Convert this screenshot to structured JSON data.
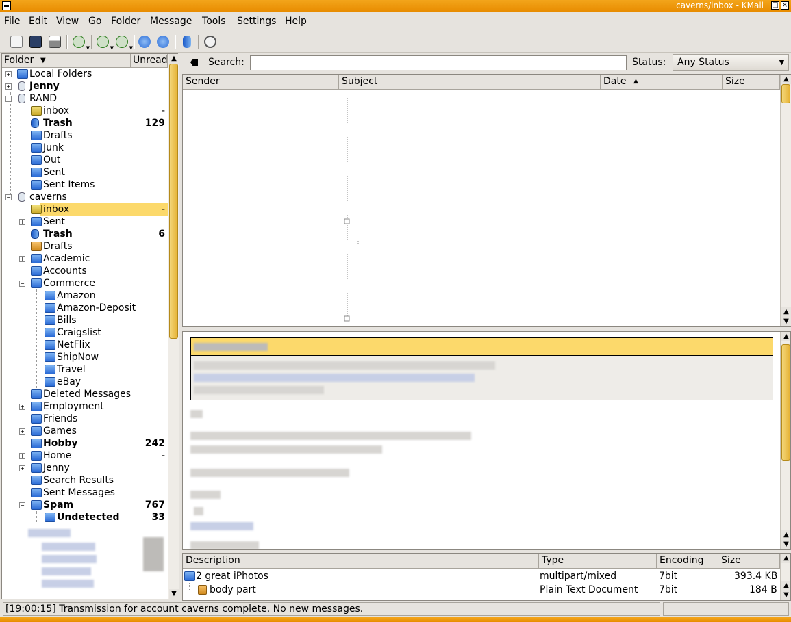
{
  "window": {
    "title": "caverns/inbox - KMail"
  },
  "menu": [
    "File",
    "Edit",
    "View",
    "Go",
    "Folder",
    "Message",
    "Tools",
    "Settings",
    "Help"
  ],
  "toolbar": {
    "icons": [
      "new-message-icon",
      "save-icon",
      "print-icon",
      "check-mail-icon",
      "reply-icon",
      "forward-icon",
      "previous-icon",
      "next-icon",
      "trash-icon",
      "find-icon"
    ]
  },
  "folder_pane": {
    "columns": [
      "Folder",
      "Unread"
    ],
    "folders": [
      {
        "name": "Local Folders",
        "count": "",
        "icon": "folder-icon",
        "indent": 0,
        "expander": "+",
        "bold": false
      },
      {
        "name": "Jenny",
        "count": "",
        "icon": "account-icon",
        "indent": 0,
        "expander": "+",
        "bold": true
      },
      {
        "name": "RAND",
        "count": "",
        "icon": "account-icon",
        "indent": 0,
        "expander": "-",
        "bold": false
      },
      {
        "name": "inbox",
        "count": "-",
        "icon": "inbox-icon",
        "indent": 1,
        "expander": "",
        "bold": false
      },
      {
        "name": "Trash",
        "count": "129",
        "icon": "trash-icon",
        "indent": 1,
        "expander": "",
        "bold": true
      },
      {
        "name": "Drafts",
        "count": "",
        "icon": "folder-icon",
        "indent": 1,
        "expander": "",
        "bold": false
      },
      {
        "name": "Junk",
        "count": "",
        "icon": "folder-icon",
        "indent": 1,
        "expander": "",
        "bold": false
      },
      {
        "name": "Out",
        "count": "",
        "icon": "folder-icon",
        "indent": 1,
        "expander": "",
        "bold": false
      },
      {
        "name": "Sent",
        "count": "",
        "icon": "folder-icon",
        "indent": 1,
        "expander": "",
        "bold": false
      },
      {
        "name": "Sent Items",
        "count": "",
        "icon": "folder-icon",
        "indent": 1,
        "expander": "",
        "bold": false
      },
      {
        "name": "caverns",
        "count": "",
        "icon": "account-icon",
        "indent": 0,
        "expander": "-",
        "bold": false
      },
      {
        "name": "inbox",
        "count": "-",
        "icon": "inbox-icon",
        "indent": 1,
        "expander": "",
        "bold": false,
        "selected": true
      },
      {
        "name": "Sent",
        "count": "",
        "icon": "folder-icon",
        "indent": 1,
        "expander": "+",
        "bold": false
      },
      {
        "name": "Trash",
        "count": "6",
        "icon": "trash-icon",
        "indent": 1,
        "expander": "",
        "bold": true
      },
      {
        "name": "Drafts",
        "count": "",
        "icon": "drafts-icon",
        "indent": 1,
        "expander": "",
        "bold": false
      },
      {
        "name": "Academic",
        "count": "",
        "icon": "folder-icon",
        "indent": 1,
        "expander": "+",
        "bold": false
      },
      {
        "name": "Accounts",
        "count": "",
        "icon": "folder-icon",
        "indent": 1,
        "expander": "",
        "bold": false
      },
      {
        "name": "Commerce",
        "count": "",
        "icon": "folder-icon",
        "indent": 1,
        "expander": "-",
        "bold": false
      },
      {
        "name": "Amazon",
        "count": "",
        "icon": "folder-icon",
        "indent": 2,
        "expander": "",
        "bold": false
      },
      {
        "name": "Amazon-Deposit",
        "count": "",
        "icon": "folder-icon",
        "indent": 2,
        "expander": "",
        "bold": false
      },
      {
        "name": "Bills",
        "count": "",
        "icon": "folder-icon",
        "indent": 2,
        "expander": "",
        "bold": false
      },
      {
        "name": "Craigslist",
        "count": "",
        "icon": "folder-icon",
        "indent": 2,
        "expander": "",
        "bold": false
      },
      {
        "name": "NetFlix",
        "count": "",
        "icon": "folder-icon",
        "indent": 2,
        "expander": "",
        "bold": false
      },
      {
        "name": "ShipNow",
        "count": "",
        "icon": "folder-icon",
        "indent": 2,
        "expander": "",
        "bold": false
      },
      {
        "name": "Travel",
        "count": "",
        "icon": "folder-icon",
        "indent": 2,
        "expander": "",
        "bold": false
      },
      {
        "name": "eBay",
        "count": "",
        "icon": "folder-icon",
        "indent": 2,
        "expander": "",
        "bold": false
      },
      {
        "name": "Deleted Messages",
        "count": "",
        "icon": "folder-icon",
        "indent": 1,
        "expander": "",
        "bold": false
      },
      {
        "name": "Employment",
        "count": "",
        "icon": "folder-icon",
        "indent": 1,
        "expander": "+",
        "bold": false
      },
      {
        "name": "Friends",
        "count": "",
        "icon": "folder-icon",
        "indent": 1,
        "expander": "",
        "bold": false
      },
      {
        "name": "Games",
        "count": "",
        "icon": "folder-icon",
        "indent": 1,
        "expander": "+",
        "bold": false
      },
      {
        "name": "Hobby",
        "count": "242",
        "icon": "folder-icon",
        "indent": 1,
        "expander": "",
        "bold": true
      },
      {
        "name": "Home",
        "count": "-",
        "icon": "folder-icon",
        "indent": 1,
        "expander": "+",
        "bold": false
      },
      {
        "name": "Jenny",
        "count": "",
        "icon": "folder-icon",
        "indent": 1,
        "expander": "+",
        "bold": false
      },
      {
        "name": "Search Results",
        "count": "",
        "icon": "folder-icon",
        "indent": 1,
        "expander": "",
        "bold": false
      },
      {
        "name": "Sent Messages",
        "count": "",
        "icon": "folder-icon",
        "indent": 1,
        "expander": "",
        "bold": false
      },
      {
        "name": "Spam",
        "count": "767",
        "icon": "folder-icon",
        "indent": 1,
        "expander": "-",
        "bold": true
      },
      {
        "name": "Undetected",
        "count": "33",
        "icon": "folder-icon",
        "indent": 2,
        "expander": "",
        "bold": true
      }
    ]
  },
  "search": {
    "label": "Search:",
    "value": "",
    "status_label": "Status:",
    "status_value": "Any Status"
  },
  "header_list": {
    "columns": [
      "Sender",
      "Subject",
      "Date",
      "Size"
    ],
    "sort_indicator": "▲"
  },
  "attachments": {
    "columns": [
      "Description",
      "Type",
      "Encoding",
      "Size"
    ],
    "rows": [
      {
        "description": "2 great iPhotos",
        "type": "multipart/mixed",
        "encoding": "7bit",
        "size": "393.4 KB"
      },
      {
        "description": "body part",
        "type": "Plain Text Document",
        "encoding": "7bit",
        "size": "184 B"
      }
    ]
  },
  "statusbar": {
    "message": "[19:00:15] Transmission for account caverns complete. No new messages."
  },
  "colors": {
    "titlebar": "#e88c00",
    "selection": "#fcd96b",
    "window_bg": "#e6e3de",
    "folder_blue": "#2a6bd6"
  }
}
